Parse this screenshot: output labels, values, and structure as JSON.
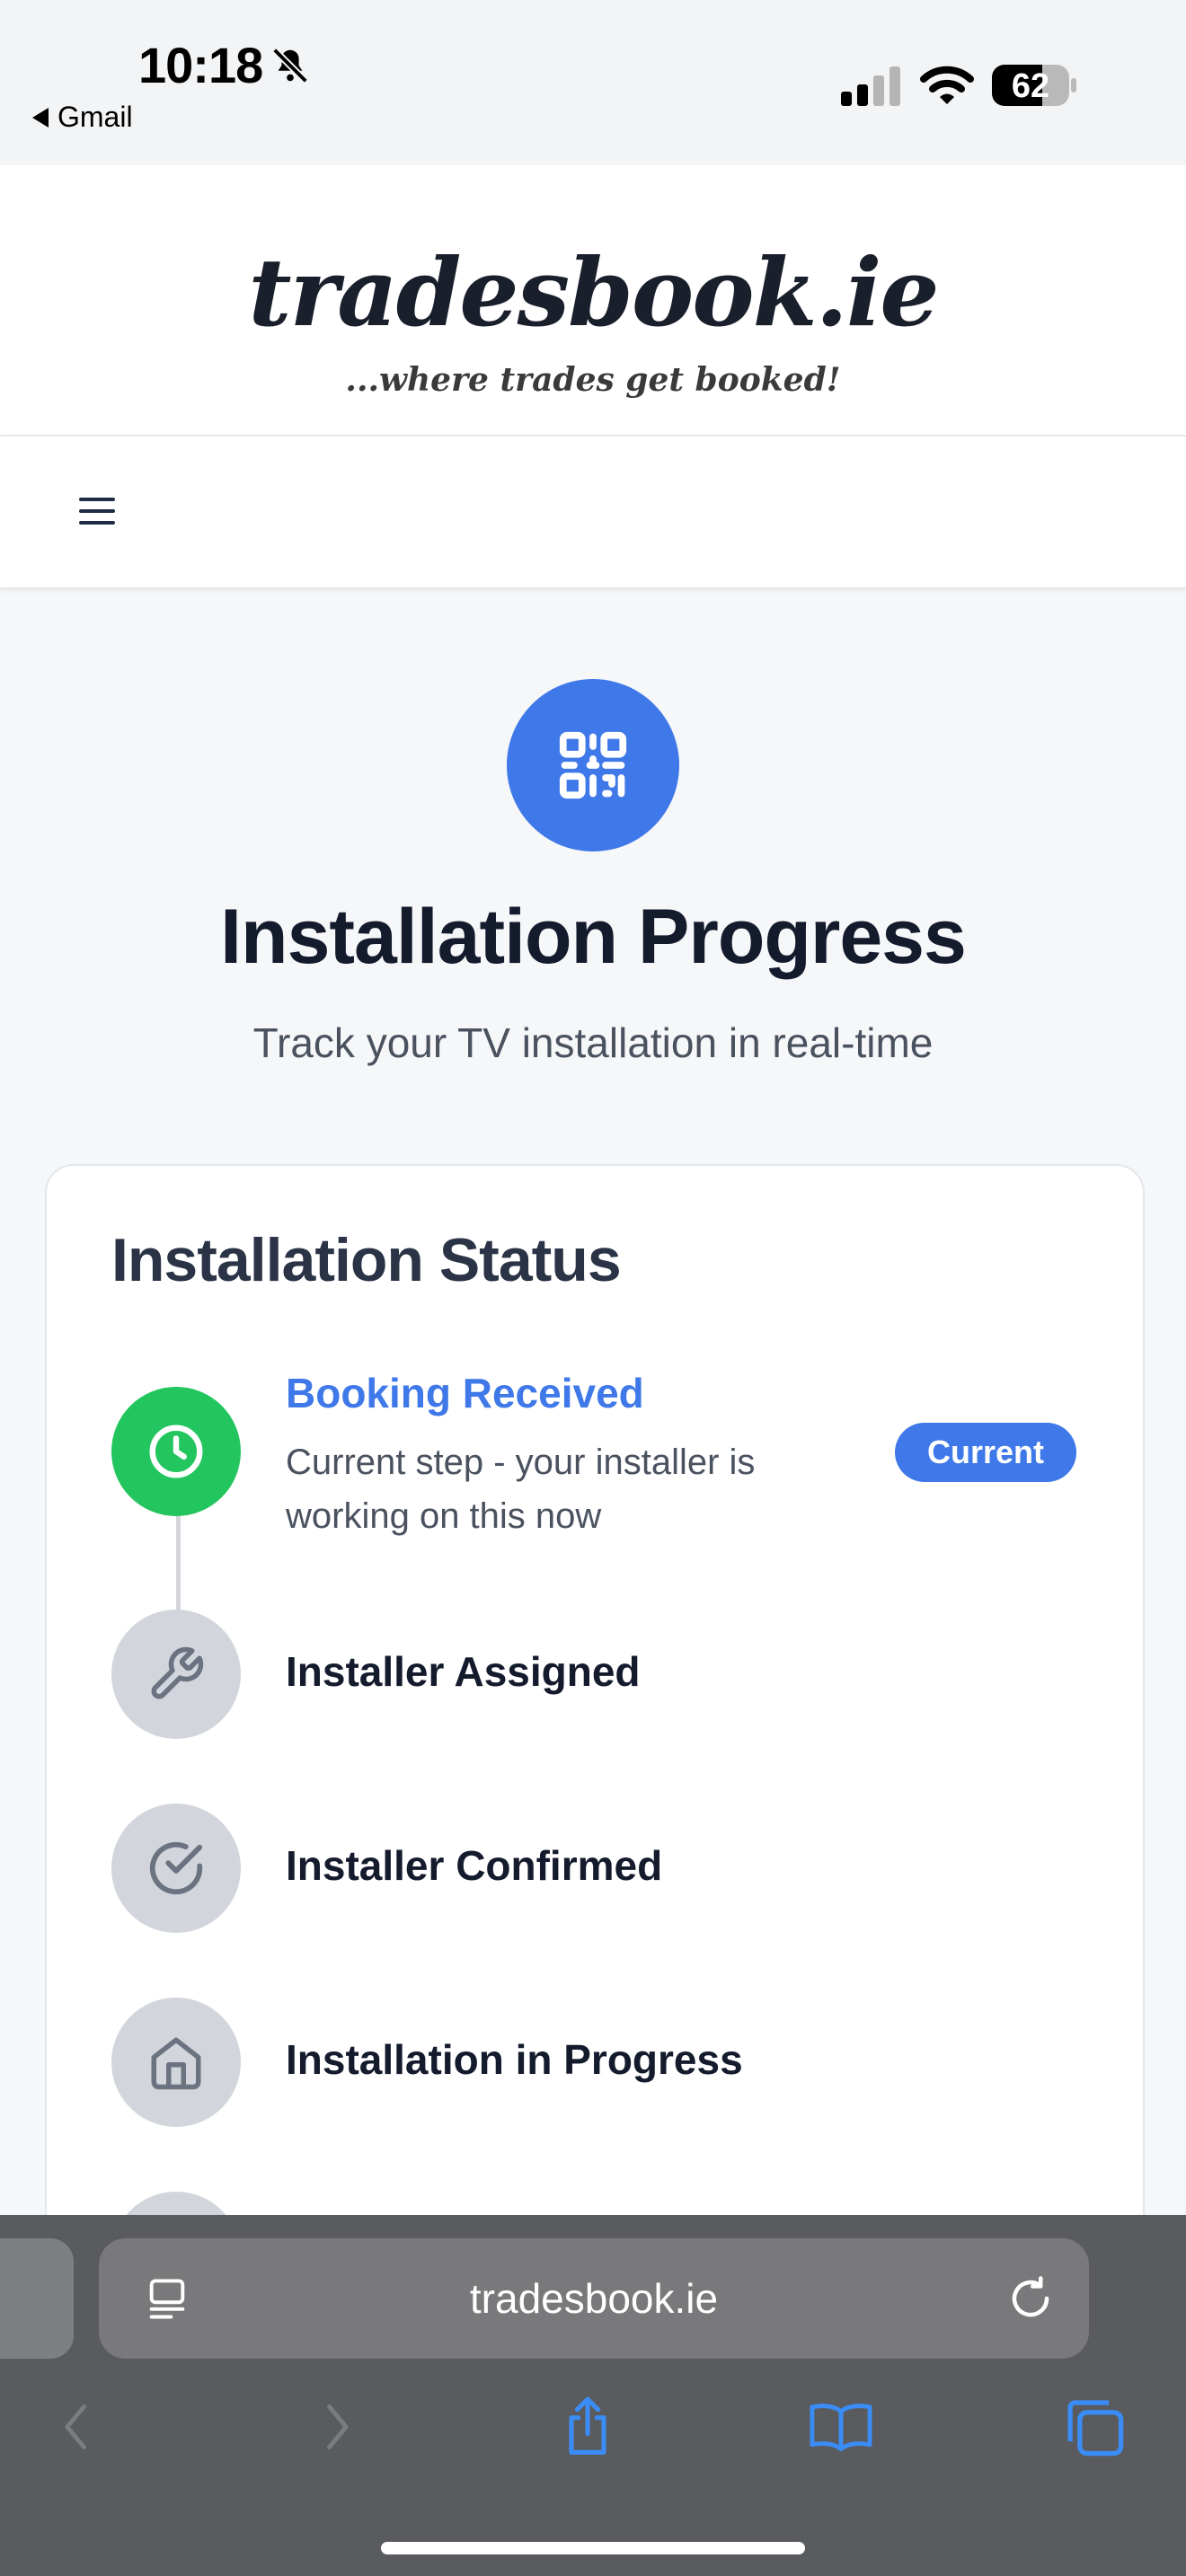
{
  "status_bar": {
    "time": "10:18",
    "back_app": "Gmail",
    "battery": "62",
    "icons": [
      "bell-slash-icon",
      "signal-icon",
      "wifi-icon",
      "battery-icon"
    ]
  },
  "header": {
    "logo": "tradesbook.ie",
    "tagline": "...where trades get booked!"
  },
  "nav": {
    "menu_icon": "hamburger-menu-icon"
  },
  "hero": {
    "icon": "qr-code-icon",
    "title": "Installation Progress",
    "subtitle": "Track your TV installation in real-time"
  },
  "status_card": {
    "title": "Installation Status",
    "steps": [
      {
        "title": "Booking Received",
        "description": "Current step - your installer is working on this now",
        "badge": "Current",
        "icon": "clock-icon",
        "state": "current"
      },
      {
        "title": "Installer Assigned",
        "icon": "wrench-icon",
        "state": "pending"
      },
      {
        "title": "Installer Confirmed",
        "icon": "check-circle-icon",
        "state": "pending"
      },
      {
        "title": "Installation in Progress",
        "icon": "home-icon",
        "state": "pending"
      }
    ]
  },
  "browser": {
    "url": "tradesbook.ie",
    "buttons": [
      "back-icon",
      "forward-icon",
      "share-icon",
      "bookmarks-icon",
      "tabs-icon"
    ]
  },
  "colors": {
    "accent": "#3f78e8",
    "done": "#22c55e",
    "pending": "#d2d5db",
    "browser_bar": "#595b5e"
  }
}
